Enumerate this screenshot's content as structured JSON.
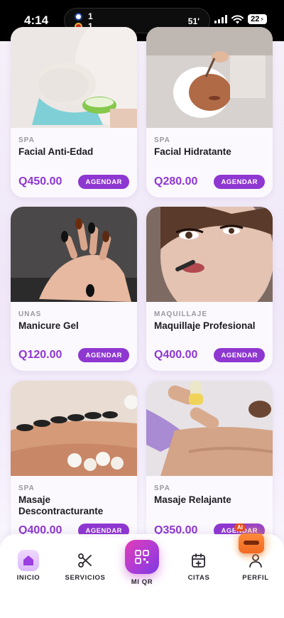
{
  "status_bar": {
    "time": "4:14",
    "score_team1": "1",
    "score_team2": "1",
    "match_minute": "51'",
    "battery": "22"
  },
  "services": [
    {
      "category": "SPA",
      "title": "Facial Anti-Edad",
      "price": "Q450.00",
      "button": "AGENDAR"
    },
    {
      "category": "SPA",
      "title": "Facial Hidratante",
      "price": "Q280.00",
      "button": "AGENDAR"
    },
    {
      "category": "UNAS",
      "title": "Manicure Gel",
      "price": "Q120.00",
      "button": "AGENDAR"
    },
    {
      "category": "MAQUILLAJE",
      "title": "Maquillaje Profesional",
      "price": "Q400.00",
      "button": "AGENDAR"
    },
    {
      "category": "SPA",
      "title": "Masaje Descontracturante",
      "price": "Q400.00",
      "button": "AGENDAR"
    },
    {
      "category": "SPA",
      "title": "Masaje Relajante",
      "price": "Q350.00",
      "button": "AGENDAR"
    }
  ],
  "nav": {
    "home": "INICIO",
    "services": "SERVICIOS",
    "qr": "MI QR",
    "appointments": "CITAS",
    "profile": "PERFIL",
    "active": "home"
  },
  "assistant": {
    "badge": "AI"
  },
  "colors": {
    "accent": "#8e37d1",
    "qr_gradient_start": "#e23db7",
    "qr_gradient_end": "#7b3be0"
  }
}
